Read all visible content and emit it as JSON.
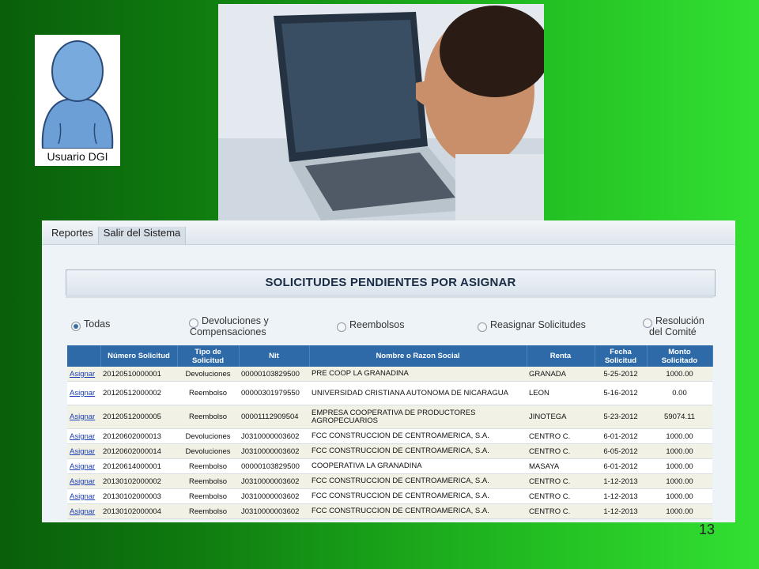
{
  "user_card": {
    "label": "Usuario DGI"
  },
  "menu": [
    "Reportes",
    "Salir del Sistema"
  ],
  "title": "SOLICITUDES PENDIENTES POR ASIGNAR",
  "filters": [
    {
      "line1": "Todas",
      "line2": "",
      "selected": true
    },
    {
      "line1": "Devoluciones y",
      "line2": "Compensaciones",
      "selected": false
    },
    {
      "line1": "Reembolsos",
      "line2": "",
      "selected": false
    },
    {
      "line1": "Reasignar Solicitudes",
      "line2": "",
      "selected": false
    },
    {
      "line1": "Resolución",
      "line2": "del Comité",
      "selected": false
    }
  ],
  "columns": [
    {
      "line1": "",
      "line2": ""
    },
    {
      "line1": "Número Solicitud",
      "line2": ""
    },
    {
      "line1": "Tipo de",
      "line2": "Solicitud"
    },
    {
      "line1": "Nit",
      "line2": ""
    },
    {
      "line1": "Nombre o Razon Social",
      "line2": ""
    },
    {
      "line1": "Renta",
      "line2": ""
    },
    {
      "line1": "Fecha",
      "line2": "Solicitud"
    },
    {
      "line1": "Monto",
      "line2": "Solicitado"
    }
  ],
  "rows": [
    {
      "action": "Asignar",
      "numero": "20120510000001",
      "tipo": "Devoluciones",
      "nit": "00000103829500",
      "nombre": "PRE COOP LA GRANADINA",
      "renta": "GRANADA",
      "fecha": "5-25-2012",
      "monto": "1000.00"
    },
    {
      "action": "Asignar",
      "numero": "20120512000002",
      "tipo": "Reembolso",
      "nit": "00000301979550",
      "nombre": "UNIVERSIDAD CRISTIANA AUTONOMA DE NICARAGUA",
      "renta": "LEON",
      "fecha": "5-16-2012",
      "monto": "0.00"
    },
    {
      "action": "Asignar",
      "numero": "20120512000005",
      "tipo": "Reembolso",
      "nit": "00001112909504",
      "nombre": "EMPRESA COOPERATIVA DE PRODUCTORES AGROPECUARIOS",
      "renta": "JINOTEGA",
      "fecha": "5-23-2012",
      "monto": "59074.11"
    },
    {
      "action": "Asignar",
      "numero": "20120602000013",
      "tipo": "Devoluciones",
      "nit": "J0310000003602",
      "nombre": "FCC CONSTRUCCION DE CENTROAMERICA, S.A.",
      "renta": "CENTRO C.",
      "fecha": "6-01-2012",
      "monto": "1000.00"
    },
    {
      "action": "Asignar",
      "numero": "20120602000014",
      "tipo": "Devoluciones",
      "nit": "J0310000003602",
      "nombre": "FCC CONSTRUCCION DE CENTROAMERICA, S.A.",
      "renta": "CENTRO C.",
      "fecha": "6-05-2012",
      "monto": "1000.00"
    },
    {
      "action": "Asignar",
      "numero": "20120614000001",
      "tipo": "Reembolso",
      "nit": "00000103829500",
      "nombre": "COOPERATIVA LA GRANADINA",
      "renta": "MASAYA",
      "fecha": "6-01-2012",
      "monto": "1000.00"
    },
    {
      "action": "Asignar",
      "numero": "20130102000002",
      "tipo": "Reembolso",
      "nit": "J0310000003602",
      "nombre": "FCC CONSTRUCCION DE CENTROAMERICA, S.A.",
      "renta": "CENTRO C.",
      "fecha": "1-12-2013",
      "monto": "1000.00"
    },
    {
      "action": "Asignar",
      "numero": "20130102000003",
      "tipo": "Reembolso",
      "nit": "J0310000003602",
      "nombre": "FCC CONSTRUCCION DE CENTROAMERICA, S.A.",
      "renta": "CENTRO C.",
      "fecha": "1-12-2013",
      "monto": "1000.00"
    },
    {
      "action": "Asignar",
      "numero": "20130102000004",
      "tipo": "Reembolso",
      "nit": "J0310000003602",
      "nombre": "FCC CONSTRUCCION DE CENTROAMERICA, S.A.",
      "renta": "CENTRO C.",
      "fecha": "1-12-2013",
      "monto": "1000.00"
    }
  ],
  "page_number": "13",
  "colors": {
    "header_blue": "#2e6aa8",
    "link_blue": "#1a3fb5",
    "slide_green": "#19a119"
  }
}
